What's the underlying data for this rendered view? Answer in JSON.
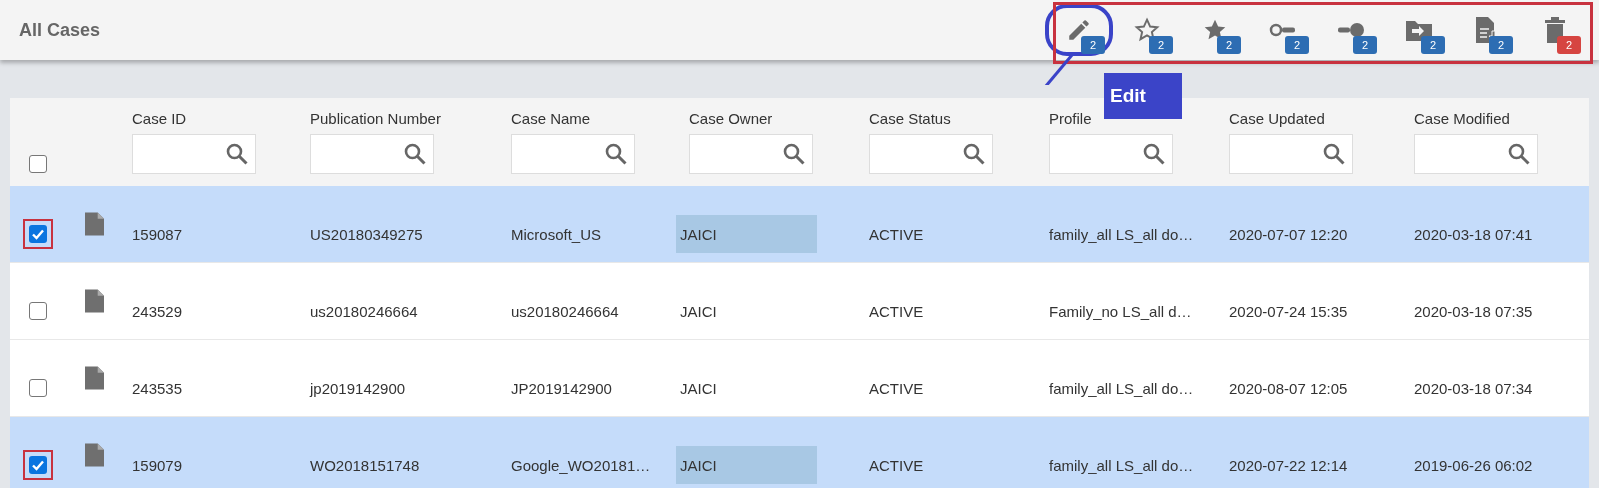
{
  "header": {
    "title": "All Cases"
  },
  "toolbar": [
    {
      "kind": "edit",
      "badge": "2",
      "color": "#2d6db3",
      "circled": true
    },
    {
      "kind": "star-outline",
      "badge": "2",
      "color": "#2d6db3"
    },
    {
      "kind": "star",
      "badge": "2",
      "color": "#2d6db3"
    },
    {
      "kind": "key-left",
      "badge": "2",
      "color": "#2d6db3"
    },
    {
      "kind": "key-right",
      "badge": "2",
      "color": "#2d6db3"
    },
    {
      "kind": "folder",
      "badge": "2",
      "color": "#2d6db3"
    },
    {
      "kind": "export",
      "badge": "2",
      "color": "#2d6db3"
    },
    {
      "kind": "delete",
      "badge": "2",
      "color": "#d64541"
    }
  ],
  "callout": {
    "label": "Edit"
  },
  "table": {
    "select_all": {
      "checked": false
    },
    "columns": [
      "Case ID",
      "Publication Number",
      "Case Name",
      "Case Owner",
      "Case Status",
      "Profile",
      "Case Updated",
      "Case Modified"
    ],
    "rows": [
      {
        "selected": true,
        "cells": [
          "159087",
          "US20180349275",
          "Microsoft_US",
          "JAICI",
          "ACTIVE",
          "family_all LS_all do…",
          "2020-07-07 12:20",
          "2020-03-18 07:41"
        ]
      },
      {
        "selected": false,
        "cells": [
          "243529",
          "us20180246664",
          "us20180246664",
          "JAICI",
          "ACTIVE",
          "Family_no LS_all d…",
          "2020-07-24 15:35",
          "2020-03-18 07:35"
        ]
      },
      {
        "selected": false,
        "cells": [
          "243535",
          "jp2019142900",
          "JP2019142900",
          "JAICI",
          "ACTIVE",
          "family_all LS_all do…",
          "2020-08-07 12:05",
          "2020-03-18 07:34"
        ]
      },
      {
        "selected": true,
        "cells": [
          "159079",
          "WO2018151748",
          "Google_WO20181…",
          "JAICI",
          "ACTIVE",
          "family_all LS_all do…",
          "2020-07-22 12:14",
          "2019-06-26 06:02"
        ]
      }
    ]
  }
}
